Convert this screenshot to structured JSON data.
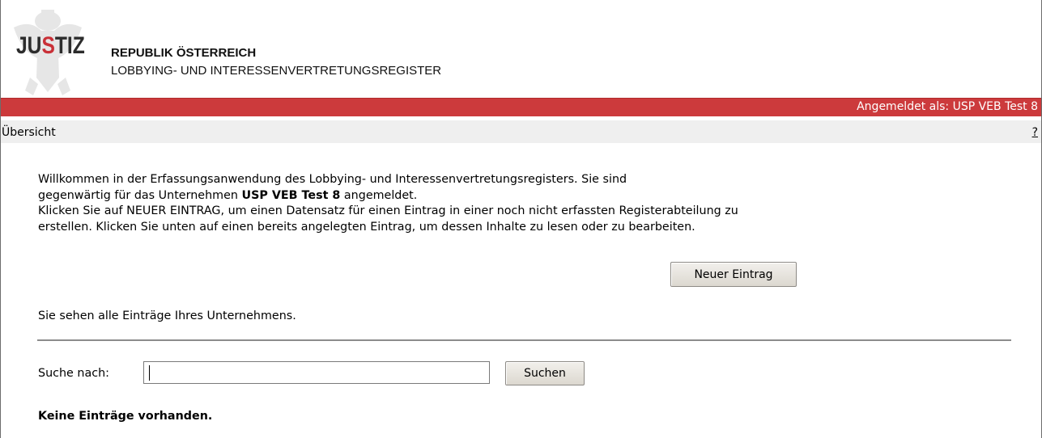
{
  "header": {
    "logo": {
      "part1": "JU",
      "part2": "S",
      "part3": "TIZ"
    },
    "title": "REPUBLIK ÖSTERREICH",
    "subtitle": "LOBBYING- UND INTERESSENVERTRETUNGSREGISTER"
  },
  "status_bar": {
    "login_text": "Angemeldet als: USP VEB Test 8"
  },
  "nav": {
    "title": "Übersicht",
    "help_label": "?"
  },
  "intro": {
    "line1": "Willkommen in der Erfassungsanwendung des Lobbying- und Interessenvertretungsregisters. Sie sind",
    "line2_before": "gegenwärtig für das Unternehmen ",
    "company": "USP VEB Test 8",
    "line2_after": " angemeldet.",
    "line3": "Klicken Sie auf NEUER EINTRAG, um einen Datensatz für einen Eintrag in einer noch nicht erfassten Registerabteilung zu",
    "line4": "erstellen. Klicken Sie unten auf einen bereits angelegten Eintrag, um dessen Inhalte zu lesen oder zu bearbeiten."
  },
  "new_entry_button": "Neuer Eintrag",
  "info_text": "Sie sehen alle Einträge Ihres Unternehmens.",
  "search": {
    "label": "Suche nach:",
    "value": "",
    "button": "Suchen"
  },
  "empty_message": "Keine Einträge vorhanden.",
  "colors": {
    "accent_red": "#cc3a3c",
    "nav_bg": "#efefef"
  }
}
